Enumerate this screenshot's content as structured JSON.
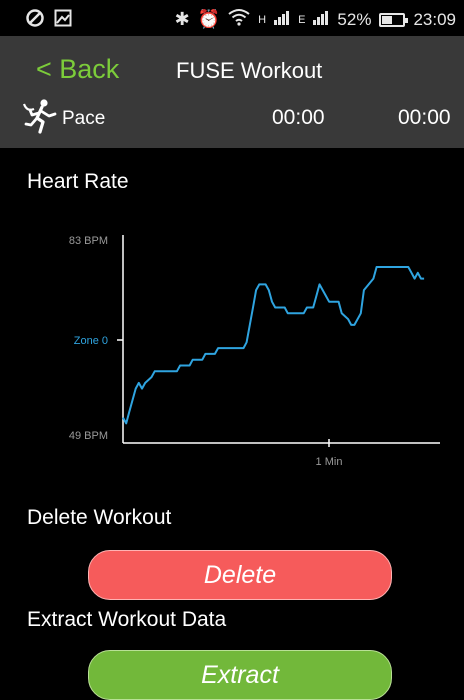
{
  "status_bar": {
    "icons": [
      "shield-icon",
      "image-icon",
      "bluetooth-icon",
      "alarm-icon",
      "wifi-icon",
      "signal-icon"
    ],
    "network_1": "H",
    "network_2": "E",
    "battery_percent": "52%",
    "battery_level": 0.52,
    "time": "23:09"
  },
  "header": {
    "back_label": "< Back",
    "title": "FUSE Workout"
  },
  "pace_row": {
    "icon": "runner-icon",
    "label": "Pace",
    "time_1": "00:00",
    "time_2": "00:00"
  },
  "heart_rate": {
    "label": "Heart Rate"
  },
  "chart_data": {
    "type": "line",
    "y_tick_labels": [
      "83 BPM",
      "Zone 0",
      "49 BPM"
    ],
    "x_tick_labels": [
      "1 Min"
    ],
    "ylim": [
      49,
      83
    ],
    "xlim": [
      0,
      100
    ],
    "series": [
      {
        "color": "#2fa4e0",
        "x": [
          0,
          1,
          2,
          4,
          5,
          6,
          7,
          9,
          10,
          12,
          13,
          17,
          18,
          21,
          22,
          25,
          26,
          29,
          30,
          33,
          34,
          38,
          39,
          40,
          41,
          42,
          43,
          45,
          46,
          47,
          48,
          49,
          51,
          52,
          54,
          55,
          57,
          58,
          60,
          61,
          62,
          64,
          65,
          66,
          67,
          68,
          69,
          71,
          72,
          73,
          75,
          76,
          79,
          80,
          81,
          82,
          83,
          90,
          91,
          92,
          93,
          94,
          95
        ],
        "y": [
          52,
          51,
          53,
          57,
          58,
          57,
          58,
          59,
          60,
          60,
          60,
          60,
          61,
          61,
          62,
          62,
          63,
          63,
          64,
          64,
          64,
          64,
          65,
          68,
          71,
          74,
          75,
          75,
          74,
          72,
          71,
          71,
          71,
          70,
          70,
          70,
          70,
          71,
          71,
          73,
          75,
          73,
          72,
          72,
          72,
          72,
          70,
          69,
          68,
          68,
          70,
          74,
          76,
          78,
          78,
          78,
          78,
          78,
          77,
          76,
          77,
          76,
          76
        ]
      }
    ]
  },
  "delete_section": {
    "label": "Delete Workout",
    "button_label": "Delete",
    "button_color": "#f65b5b"
  },
  "extract_section": {
    "label": "Extract Workout Data",
    "button_label": "Extract",
    "button_color": "#72b83a"
  },
  "accent_color": "#7ccc3a"
}
